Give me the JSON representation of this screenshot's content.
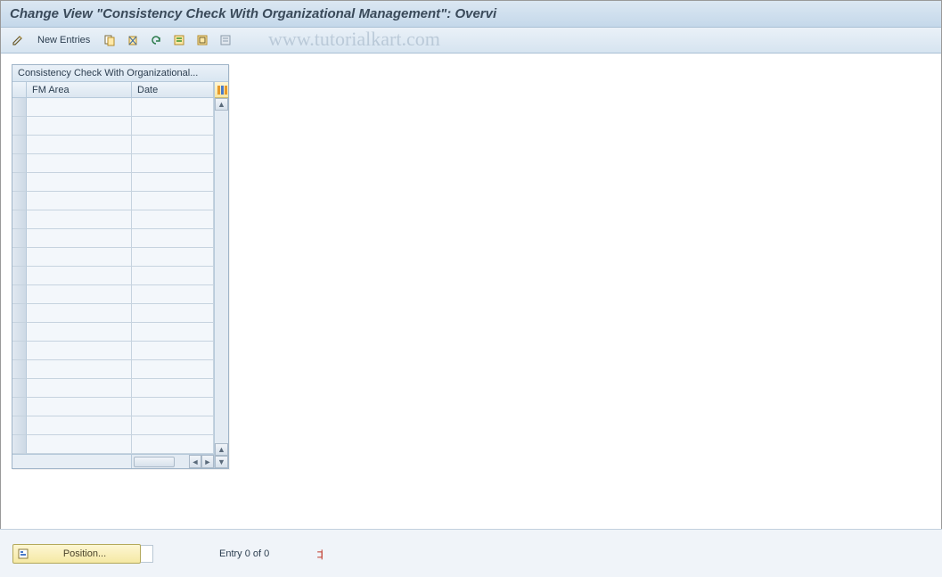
{
  "title": "Change View \"Consistency Check With Organizational Management\": Overvi",
  "toolbar": {
    "new_entries_label": "New Entries"
  },
  "panel": {
    "title": "Consistency Check With Organizational...",
    "columns": {
      "fm_area": "FM Area",
      "date": "Date"
    },
    "row_count": 19
  },
  "footer": {
    "position_label": "Position...",
    "entry_text": "Entry 0 of 0"
  },
  "watermark": "www.tutorialkart.com"
}
